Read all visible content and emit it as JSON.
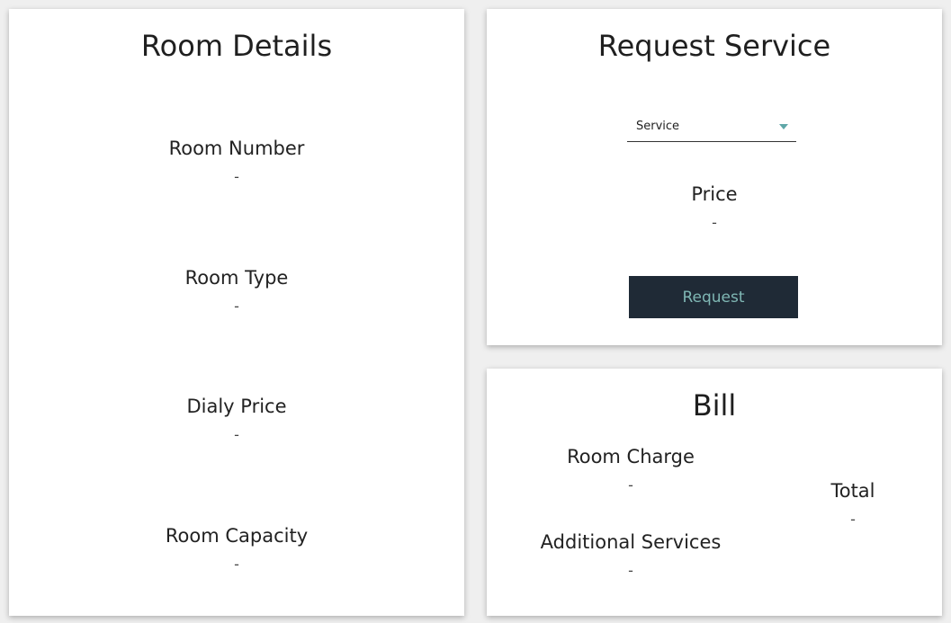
{
  "room_details": {
    "title": "Room Details",
    "fields": [
      {
        "label": "Room Number",
        "value": "-"
      },
      {
        "label": "Room Type",
        "value": "-"
      },
      {
        "label": "Dialy Price",
        "value": "-"
      },
      {
        "label": "Room Capacity",
        "value": "-"
      }
    ]
  },
  "request_service": {
    "title": "Request Service",
    "dropdown": {
      "selected": "Service"
    },
    "price_label": "Price",
    "price_value": "-",
    "button_label": "Request"
  },
  "bill": {
    "title": "Bill",
    "room_charge_label": "Room Charge",
    "room_charge_value": "-",
    "additional_services_label": "Additional Services",
    "additional_services_value": "-",
    "total_label": "Total",
    "total_value": "-"
  },
  "colors": {
    "button_bg": "#1f2a36",
    "button_text": "#7fb7b4",
    "accent": "#5fa7a8"
  }
}
